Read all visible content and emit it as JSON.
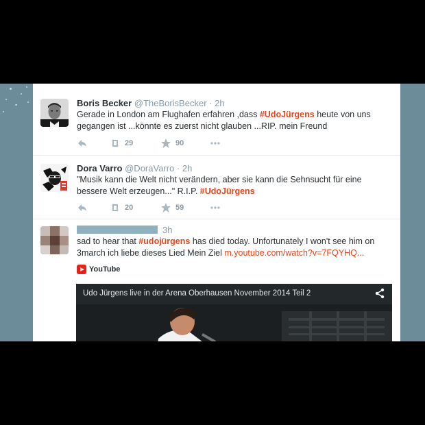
{
  "tweets": [
    {
      "name": "Boris Becker",
      "handle": "@TheBorisBecker",
      "time": "· 2h",
      "text_before": "Gerade in London am Flughafen erfahren ,dass ",
      "hashtag": "#UdoJürgens",
      "text_after": " heute von uns gegangen ist ...könnte es zuerst nicht glauben ...RIP. mein Freund",
      "retweets": "29",
      "favorites": "90"
    },
    {
      "name": "Dora Varro",
      "handle": "@DoraVarro",
      "time": "· 2h",
      "text_before": "\"Musik kann die Welt nicht verändern, aber sie kann die Sehnsucht für eine bessere Welt erzeugen...\" R.I.P. ",
      "hashtag": "#UdoJürgens",
      "retweets": "20",
      "favorites": "59"
    },
    {
      "time": "3h",
      "text_before": "sad to hear that  ",
      "hashtag": "#udojürgens",
      "text_middle": " has died today. Unfortunately I won't see him on 3march ich liebe dieses Lied Mein Ziel ",
      "link": "m.youtube.com/watch?v=7FQYHQ...",
      "card_source": "YouTube",
      "video_title": "Udo Jürgens live in der Arena Oberhausen November 2014 Teil 2"
    }
  ],
  "icons": {
    "reply": "reply-icon",
    "retweet": "retweet-icon",
    "favorite": "star-icon",
    "more": "more-icon",
    "share": "share-icon",
    "youtube": "youtube-icon"
  },
  "colors": {
    "hashtag": "#e0471e",
    "background": "#6b8c98",
    "muted": "#8899a6"
  }
}
